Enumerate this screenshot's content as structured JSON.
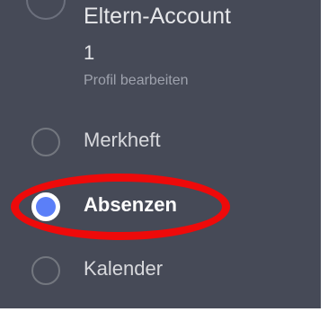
{
  "account": {
    "name": "Eltern-Account",
    "id": "1",
    "edit_profile_label": "Profil bearbeiten"
  },
  "nav": {
    "items": [
      {
        "label": "Merkheft",
        "selected": false
      },
      {
        "label": "Absenzen",
        "selected": true
      },
      {
        "label": "Kalender",
        "selected": false
      }
    ]
  },
  "colors": {
    "panel_background": "#464a57",
    "accent": "#5b7ff8",
    "highlight_annotation": "#ee0a0a"
  },
  "icons": {
    "avatar": "avatar-icon",
    "radio": "radio-icon"
  }
}
